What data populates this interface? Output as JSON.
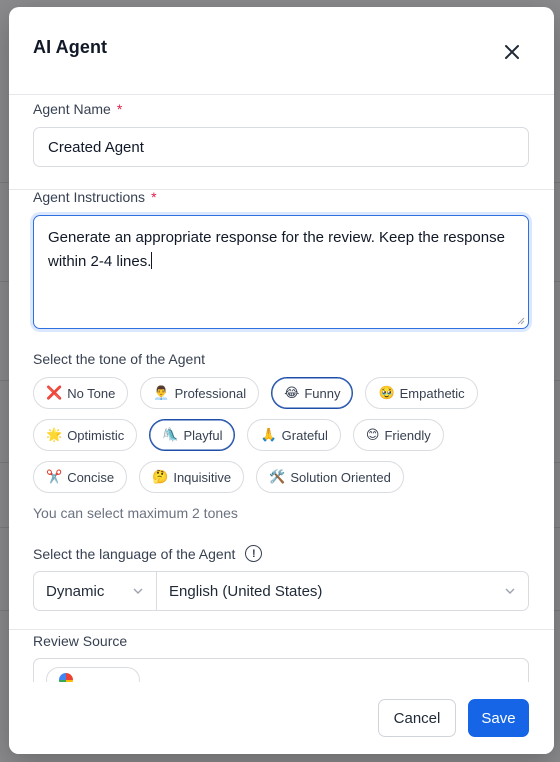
{
  "modal": {
    "title": "AI Agent"
  },
  "agent_name": {
    "label": "Agent Name",
    "required_mark": "*",
    "value": "Created Agent"
  },
  "agent_instructions": {
    "label": "Agent Instructions",
    "required_mark": "*",
    "value": "Generate an appropriate response for the review. Keep the response within 2-4 lines."
  },
  "tone": {
    "label": "Select the tone of the Agent",
    "rows": [
      [
        {
          "emoji": "❌",
          "label": "No Tone",
          "selected": false
        },
        {
          "emoji": "👨‍💼",
          "label": "Professional",
          "selected": false
        },
        {
          "emoji": "😂",
          "label": "Funny",
          "selected": true
        },
        {
          "emoji": "🥹",
          "label": "Empathetic",
          "selected": false
        }
      ],
      [
        {
          "emoji": "🌟",
          "label": "Optimistic",
          "selected": false
        },
        {
          "emoji": "🛝",
          "label": "Playful",
          "selected": true
        },
        {
          "emoji": "🙏",
          "label": "Grateful",
          "selected": false
        },
        {
          "emoji": "😊",
          "label": "Friendly",
          "selected": false
        }
      ],
      [
        {
          "emoji": "✂️",
          "label": "Concise",
          "selected": false
        },
        {
          "emoji": "🤔",
          "label": "Inquisitive",
          "selected": false
        },
        {
          "emoji": "🛠️",
          "label": "Solution Oriented",
          "selected": false
        }
      ]
    ],
    "hint": "You can select maximum 2 tones"
  },
  "language": {
    "label": "Select the language of the Agent",
    "info_icon": "info-icon",
    "mode_value": "Dynamic",
    "language_value": "English (United States)"
  },
  "review_source": {
    "label": "Review Source"
  },
  "footer": {
    "cancel_label": "Cancel",
    "save_label": "Save"
  },
  "colors": {
    "primary": "#1565e6",
    "required": "#e11d48",
    "selected_chip_border": "#1e4fa8"
  }
}
